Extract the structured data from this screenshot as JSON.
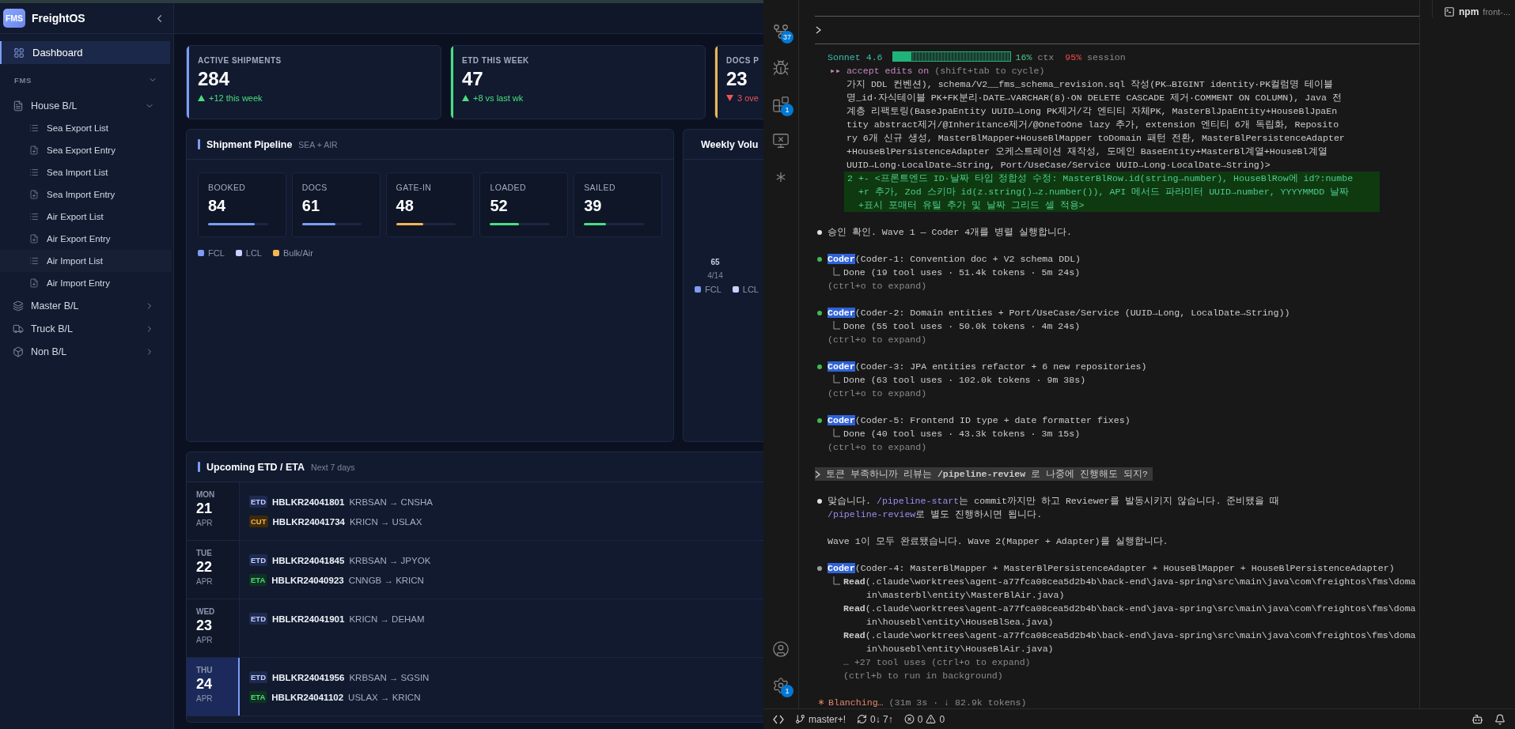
{
  "sidebar": {
    "brand": {
      "logo": "FMS",
      "name": "FreightOS"
    },
    "dashboard": {
      "label": "Dashboard",
      "selected": true
    },
    "section": {
      "label": "FMS",
      "expanded": true
    },
    "groups": [
      {
        "label": "House B/L",
        "kind": "document",
        "expanded": true,
        "children": [
          {
            "label": "Sea Export List",
            "kind": "list",
            "hovered": false
          },
          {
            "label": "Sea Export Entry",
            "kind": "entry",
            "hovered": false
          },
          {
            "label": "Sea Import List",
            "kind": "list",
            "hovered": false
          },
          {
            "label": "Sea Import Entry",
            "kind": "entry",
            "hovered": false
          },
          {
            "label": "Air Export List",
            "kind": "list",
            "hovered": false
          },
          {
            "label": "Air Export Entry",
            "kind": "entry",
            "hovered": false
          },
          {
            "label": "Air Import List",
            "kind": "list",
            "hovered": true
          },
          {
            "label": "Air Import Entry",
            "kind": "entry",
            "hovered": false
          }
        ]
      },
      {
        "label": "Master B/L",
        "kind": "layers",
        "expanded": false
      },
      {
        "label": "Truck B/L",
        "kind": "truck",
        "expanded": false
      },
      {
        "label": "Non B/L",
        "kind": "box",
        "expanded": false
      }
    ]
  },
  "kpis": [
    {
      "label": "ACTIVE SHIPMENTS",
      "value": "284",
      "delta": "+12 this week",
      "kind": "up",
      "color": "#7c9cf5"
    },
    {
      "label": "ETD THIS WEEK",
      "value": "47",
      "delta": "+8 vs last wk",
      "kind": "up",
      "color": "#4ade80"
    },
    {
      "label": "DOCS P",
      "value": "23",
      "delta": "3 ove",
      "kind": "down",
      "color": "#f5b553"
    }
  ],
  "pipeline": {
    "title": "Shipment Pipeline",
    "subtitle": "SEA + AIR",
    "stages": [
      {
        "label": "BOOKED",
        "value": "84",
        "level": 0.78,
        "color": "#7c9cf5"
      },
      {
        "label": "DOCS",
        "value": "61",
        "level": 0.56,
        "color": "#7c9cf5"
      },
      {
        "label": "GATE-IN",
        "value": "48",
        "level": 0.45,
        "color": "#f5b553"
      },
      {
        "label": "LOADED",
        "value": "52",
        "level": 0.48,
        "color": "#4ade80"
      },
      {
        "label": "SAILED",
        "value": "39",
        "level": 0.37,
        "color": "#4ade80"
      }
    ],
    "legend": [
      {
        "label": "FCL",
        "color": "#7c9cf5"
      },
      {
        "label": "LCL",
        "color": "#c7d2fe"
      },
      {
        "label": "Bulk/Air",
        "color": "#f5b553"
      }
    ]
  },
  "weekly": {
    "title": "Weekly Volu",
    "bar_value": "65",
    "bar_label": "4/14",
    "legend": [
      {
        "label": "FCL",
        "color": "#7c9cf5"
      },
      {
        "label": "LCL",
        "color": "#c7d2fe"
      }
    ]
  },
  "upcoming": {
    "title": "Upcoming ETD / ETA",
    "subtitle": "Next 7 days",
    "days": [
      {
        "dow": "MON",
        "day": "21",
        "month": "APR",
        "selected": false,
        "events": [
          {
            "badge": "ETD",
            "kind": "etd",
            "ref": "HBLKR24041801",
            "route": "KRBSAN → CNSHA"
          },
          {
            "badge": "CUT",
            "kind": "cut",
            "ref": "HBLKR24041734",
            "route": "KRICN → USLAX"
          }
        ]
      },
      {
        "dow": "TUE",
        "day": "22",
        "month": "APR",
        "selected": false,
        "events": [
          {
            "badge": "ETD",
            "kind": "etd",
            "ref": "HBLKR24041845",
            "route": "KRBSAN → JPYOK"
          },
          {
            "badge": "ETA",
            "kind": "eta",
            "ref": "HBLKR24040923",
            "route": "CNNGB → KRICN"
          }
        ]
      },
      {
        "dow": "WED",
        "day": "23",
        "month": "APR",
        "selected": false,
        "events": [
          {
            "badge": "ETD",
            "kind": "etd",
            "ref": "HBLKR24041901",
            "route": "KRICN → DEHAM"
          }
        ]
      },
      {
        "dow": "THU",
        "day": "24",
        "month": "APR",
        "selected": true,
        "events": [
          {
            "badge": "ETD",
            "kind": "etd",
            "ref": "HBLKR24041956",
            "route": "KRBSAN → SGSIN"
          },
          {
            "badge": "ETA",
            "kind": "eta",
            "ref": "HBLKR24041102",
            "route": "USLAX → KRICN"
          }
        ]
      }
    ]
  },
  "activity_bar": {
    "top": [
      {
        "kind": "source-control",
        "badge": "37"
      },
      {
        "kind": "run-debug"
      },
      {
        "kind": "extensions",
        "badge": "1"
      },
      {
        "kind": "remote"
      },
      {
        "kind": "sparkle"
      }
    ],
    "bottom": [
      {
        "kind": "account"
      },
      {
        "kind": "settings",
        "badge": "1"
      }
    ]
  },
  "terminal": {
    "status": {
      "model": "Sonnet 4.6",
      "level": 0.16,
      "ctx": "16%",
      "ctx_label": "ctx",
      "session": "95%",
      "session_label": "session"
    },
    "mode": {
      "label": "▸▸ accept edits on",
      "hint": "(shift+tab to cycle)"
    },
    "entries": [
      {
        "kind": "text",
        "lines": [
          "가지 DDL 컨벤션), schema/V2__fms_schema_revision.sql 작성(PK→BIGINT identity·PK컬럼명 테이블",
          "명_id·자식테이블 PK+FK분리·DATE→VARCHAR(8)·ON DELETE CASCADE 제거·COMMENT ON COLUMN), Java 전",
          "계층 리팩토링(BaseJpaEntity UUID→Long PK제거/각 엔티티 자체PK, MasterBlJpaEntity+HouseBlJpaEn",
          "tity abstract제거/@Inheritance제거/@OneToOne lazy 추가, extension 엔티티 6개 독립화, Reposito",
          "ry 6개 신규 생성, MasterBlMapper+HouseBlMapper toDomain 패턴 전환, MasterBlPersistenceAdapter",
          "+HouseBlPersistenceAdapter 오케스트레이션 재작성, 도메인 BaseEntity+MasterBl계열+HouseBl계열",
          "UUID→Long·LocalDate→String, Port/UseCase/Service UUID→Long·LocalDate→String)>"
        ]
      },
      {
        "kind": "diff",
        "lines": [
          "2 +- <프론트엔드 ID·날짜 타입 정합성 수정: MasterBlRow.id(string→number), HouseBlRow에 id?:numbe",
          "+r 추가, Zod 스키마 id(z.string()→z.number()), API 메서드 파라미터 UUID→number, YYYYMMDD 날짜",
          "+표시 포매터 유틸 추가 및 날짜 그리드 셀 적용>"
        ]
      },
      {
        "kind": "message",
        "bullet": true,
        "lines": [
          [
            {
              "text": "승인 확인. Wave 1 — Coder 4개를 병렬 실행합니다."
            }
          ]
        ]
      },
      {
        "kind": "task",
        "done": true,
        "agent": "Coder",
        "title": "(Coder-1: Convention doc + V2 schema DDL)",
        "result": "Done (19 tool uses · 51.4k tokens · 5m 24s)",
        "hint": "(ctrl+o to expand)"
      },
      {
        "kind": "task",
        "done": true,
        "agent": "Coder",
        "title": "(Coder-2: Domain entities + Port/UseCase/Service (UUID→Long, LocalDate→String))",
        "result": "Done (55 tool uses · 50.0k tokens · 4m 24s)",
        "hint": "(ctrl+o to expand)"
      },
      {
        "kind": "task",
        "done": true,
        "agent": "Coder",
        "title": "(Coder-3: JPA entities refactor + 6 new repositories)",
        "result": "Done (63 tool uses · 102.0k tokens · 9m 38s)",
        "hint": "(ctrl+o to expand)"
      },
      {
        "kind": "task",
        "done": true,
        "agent": "Coder",
        "title": "(Coder-5: Frontend ID type + date formatter fixes)",
        "result": "Done (40 tool uses · 43.3k tokens · 3m 15s)",
        "hint": "(ctrl+o to expand)"
      },
      {
        "kind": "user",
        "text": "토큰 부족하니까 리뷰는 **/pipeline-review** 로 나중에 진행해도 되지?"
      },
      {
        "kind": "message",
        "bullet": true,
        "lines": [
          [
            {
              "text": "맞습니다. "
            },
            {
              "text": "/pipeline-start",
              "kind": "command"
            },
            {
              "text": "는 commit까지만 하고 Reviewer를 발동시키지 않습니다. 준비됐을 때"
            }
          ],
          [
            {
              "text": "/pipeline-review",
              "kind": "command"
            },
            {
              "text": "로 별도 진행하시면 됩니다."
            }
          ]
        ]
      },
      {
        "kind": "message",
        "bullet": false,
        "lines": [
          [
            {
              "text": "Wave 1이 모두 완료됐습니다. Wave 2(Mapper + Adapter)를 실행합니다."
            }
          ]
        ]
      },
      {
        "kind": "task",
        "done": false,
        "agent": "Coder",
        "title": "(Coder-4: MasterBlMapper + MasterBlPersistenceAdapter + HouseBlMapper + HouseBlPersistenceAdapter)",
        "steps": [
          {
            "tool": "Read",
            "lines": [
              "(.claude\\worktrees\\agent-a77fca08cea5d2b4b\\back-end\\java-spring\\src\\main\\java\\com\\freightos\\fms\\doma",
              "in\\masterbl\\entity\\MasterBlAir.java)"
            ]
          },
          {
            "tool": "Read",
            "lines": [
              "(.claude\\worktrees\\agent-a77fca08cea5d2b4b\\back-end\\java-spring\\src\\main\\java\\com\\freightos\\fms\\doma",
              "in\\housebl\\entity\\HouseBlSea.java)"
            ]
          },
          {
            "tool": "Read",
            "lines": [
              "(.claude\\worktrees\\agent-a77fca08cea5d2b4b\\back-end\\java-spring\\src\\main\\java\\com\\freightos\\fms\\doma",
              "in\\housebl\\entity\\HouseBlAir.java)"
            ]
          }
        ],
        "more": "… +27 tool uses (ctrl+o to expand)",
        "hint": "(ctrl+b to run in background)"
      },
      {
        "kind": "spinner",
        "label": "Blanching…",
        "detail": "(31m 3s · ↓ 82.9k tokens)"
      }
    ]
  },
  "side_panel": {
    "label": "npm",
    "detail": "front-..."
  },
  "status_bar": {
    "branch": "master+!",
    "sync": "0↓ 7↑",
    "errors": "0",
    "warnings": "0"
  }
}
